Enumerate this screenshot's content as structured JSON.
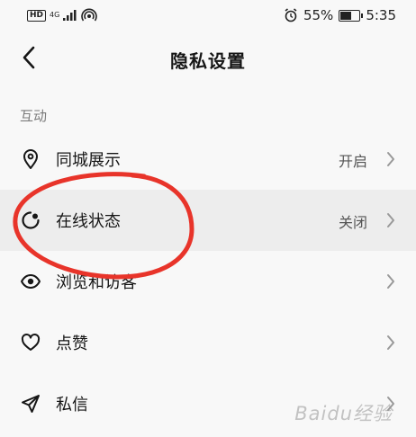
{
  "status_bar": {
    "hd_badge": "HD",
    "network": "4G",
    "battery_percent": "55%",
    "battery_level": 0.55,
    "time": "5:35"
  },
  "header": {
    "title": "隐私设置",
    "back_icon": "chevron-left-icon"
  },
  "section": {
    "label": "互动"
  },
  "rows": [
    {
      "label": "同城展示",
      "value": "开启",
      "icon": "location-pin-icon"
    },
    {
      "label": "在线状态",
      "value": "关闭",
      "icon": "online-status-icon"
    },
    {
      "label": "浏览和访客",
      "value": "",
      "icon": "eye-icon"
    },
    {
      "label": "点赞",
      "value": "",
      "icon": "heart-icon"
    },
    {
      "label": "私信",
      "value": "",
      "icon": "paper-plane-icon"
    }
  ],
  "annotation": {
    "color": "#e8342a"
  },
  "watermark": {
    "text": "Baidu经验"
  }
}
